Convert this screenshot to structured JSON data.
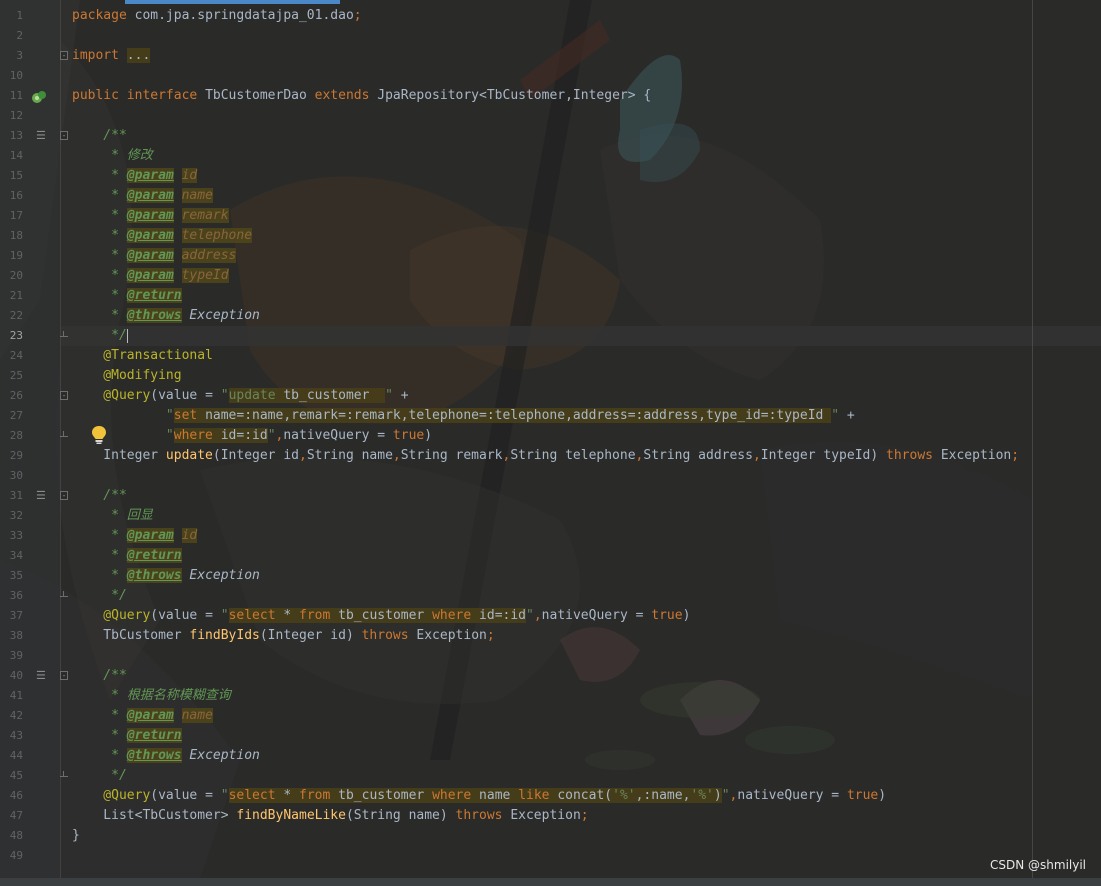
{
  "editor": {
    "lines": [
      {
        "n": "1",
        "segs": [
          [
            "kw",
            "package "
          ],
          [
            "",
            "com.jpa.springdatajpa_01.dao"
          ],
          [
            "kw",
            ";"
          ]
        ]
      },
      {
        "n": "2",
        "segs": []
      },
      {
        "n": "3",
        "fold": "open",
        "segs": [
          [
            "kw",
            "import "
          ],
          [
            "hl",
            "..."
          ]
        ]
      },
      {
        "n": "10",
        "segs": []
      },
      {
        "n": "11",
        "bean": true,
        "segs": [
          [
            "kw",
            "public interface "
          ],
          [
            "",
            "TbCustomerDao "
          ],
          [
            "kw",
            "extends "
          ],
          [
            "",
            "JpaRepository<TbCustomer,Integer> {"
          ]
        ]
      },
      {
        "n": "12",
        "segs": []
      },
      {
        "n": "13",
        "fold": "open",
        "rend": true,
        "segs": [
          [
            "doc",
            "    /**"
          ]
        ]
      },
      {
        "n": "14",
        "segs": [
          [
            "doc",
            "     * 修改"
          ]
        ]
      },
      {
        "n": "15",
        "segs": [
          [
            "doc",
            "     * "
          ],
          [
            "tag",
            "@param"
          ],
          [
            "doc",
            " "
          ],
          [
            "dval",
            "id"
          ]
        ]
      },
      {
        "n": "16",
        "segs": [
          [
            "doc",
            "     * "
          ],
          [
            "tag",
            "@param"
          ],
          [
            "doc",
            " "
          ],
          [
            "dval",
            "name"
          ]
        ]
      },
      {
        "n": "17",
        "segs": [
          [
            "doc",
            "     * "
          ],
          [
            "tag",
            "@param"
          ],
          [
            "doc",
            " "
          ],
          [
            "dval",
            "remark"
          ]
        ]
      },
      {
        "n": "18",
        "segs": [
          [
            "doc",
            "     * "
          ],
          [
            "tag",
            "@param"
          ],
          [
            "doc",
            " "
          ],
          [
            "dval",
            "telephone"
          ]
        ]
      },
      {
        "n": "19",
        "segs": [
          [
            "doc",
            "     * "
          ],
          [
            "tag",
            "@param"
          ],
          [
            "doc",
            " "
          ],
          [
            "dval",
            "address"
          ]
        ]
      },
      {
        "n": "20",
        "segs": [
          [
            "doc",
            "     * "
          ],
          [
            "tag",
            "@param"
          ],
          [
            "doc",
            " "
          ],
          [
            "dval",
            "typeId"
          ]
        ]
      },
      {
        "n": "21",
        "segs": [
          [
            "doc",
            "     * "
          ],
          [
            "tag",
            "@return"
          ]
        ]
      },
      {
        "n": "22",
        "segs": [
          [
            "doc",
            "     * "
          ],
          [
            "tag",
            "@throws"
          ],
          [
            "doc",
            " "
          ],
          [
            "exc",
            "Exception"
          ]
        ]
      },
      {
        "n": "23",
        "fold": "end",
        "cur": true,
        "segs": [
          [
            "doc",
            "     */"
          ],
          [
            "caret",
            ""
          ]
        ]
      },
      {
        "n": "24",
        "segs": [
          [
            "ann",
            "    @Transactional"
          ]
        ]
      },
      {
        "n": "25",
        "segs": [
          [
            "ann",
            "    @Modifying"
          ]
        ]
      },
      {
        "n": "26",
        "fold": "open",
        "segs": [
          [
            "ann",
            "    @Query"
          ],
          [
            "",
            "(value = "
          ],
          [
            "str",
            "\""
          ],
          [
            "hl str",
            "update "
          ],
          [
            "hl",
            "tb_customer  "
          ],
          [
            "str",
            "\""
          ],
          [
            "",
            " +"
          ]
        ]
      },
      {
        "n": "27",
        "segs": [
          [
            "str",
            "            \""
          ],
          [
            "hl kw",
            "set "
          ],
          [
            "hl",
            "name=:name,remark=:remark,telephone=:telephone,address=:address,type_id=:typeId "
          ],
          [
            "str",
            "\""
          ],
          [
            "",
            " +"
          ]
        ]
      },
      {
        "n": "28",
        "bulb": true,
        "fold": "end",
        "segs": [
          [
            "str",
            "            \""
          ],
          [
            "hl kw",
            "where "
          ],
          [
            "hl",
            "id=:id"
          ],
          [
            "str",
            "\""
          ],
          [
            "kw",
            ","
          ],
          [
            "",
            "nativeQuery = "
          ],
          [
            "kw",
            "true"
          ],
          [
            "",
            ")"
          ]
        ]
      },
      {
        "n": "29",
        "segs": [
          [
            "",
            "    Integer "
          ],
          [
            "fn",
            "update"
          ],
          [
            "",
            "(Integer id"
          ],
          [
            "kw",
            ","
          ],
          [
            "",
            "String name"
          ],
          [
            "kw",
            ","
          ],
          [
            "",
            "String remark"
          ],
          [
            "kw",
            ","
          ],
          [
            "",
            "String telephone"
          ],
          [
            "kw",
            ","
          ],
          [
            "",
            "String address"
          ],
          [
            "kw",
            ","
          ],
          [
            "",
            "Integer typeId) "
          ],
          [
            "kw",
            "throws "
          ],
          [
            "",
            "Exception"
          ],
          [
            "kw",
            ";"
          ]
        ]
      },
      {
        "n": "30",
        "segs": []
      },
      {
        "n": "31",
        "fold": "open",
        "rend": true,
        "segs": [
          [
            "doc",
            "    /**"
          ]
        ]
      },
      {
        "n": "32",
        "segs": [
          [
            "doc",
            "     * 回显"
          ]
        ]
      },
      {
        "n": "33",
        "segs": [
          [
            "doc",
            "     * "
          ],
          [
            "tag",
            "@param"
          ],
          [
            "doc",
            " "
          ],
          [
            "dval",
            "id"
          ]
        ]
      },
      {
        "n": "34",
        "segs": [
          [
            "doc",
            "     * "
          ],
          [
            "tag",
            "@return"
          ]
        ]
      },
      {
        "n": "35",
        "segs": [
          [
            "doc",
            "     * "
          ],
          [
            "tag",
            "@throws"
          ],
          [
            "doc",
            " "
          ],
          [
            "exc",
            "Exception"
          ]
        ]
      },
      {
        "n": "36",
        "fold": "end",
        "segs": [
          [
            "doc",
            "     */"
          ]
        ]
      },
      {
        "n": "37",
        "segs": [
          [
            "ann",
            "    @Query"
          ],
          [
            "",
            "(value = "
          ],
          [
            "str",
            "\""
          ],
          [
            "hl kw",
            "select "
          ],
          [
            "hl",
            "* "
          ],
          [
            "hl kw",
            "from "
          ],
          [
            "hl",
            "tb_customer "
          ],
          [
            "hl kw",
            "where "
          ],
          [
            "hl",
            "id=:id"
          ],
          [
            "str",
            "\""
          ],
          [
            "kw",
            ","
          ],
          [
            "",
            "nativeQuery = "
          ],
          [
            "kw",
            "true"
          ],
          [
            "",
            ")"
          ]
        ]
      },
      {
        "n": "38",
        "segs": [
          [
            "",
            "    TbCustomer "
          ],
          [
            "fn",
            "findByIds"
          ],
          [
            "",
            "(Integer id) "
          ],
          [
            "kw",
            "throws "
          ],
          [
            "",
            "Exception"
          ],
          [
            "kw",
            ";"
          ]
        ]
      },
      {
        "n": "39",
        "segs": []
      },
      {
        "n": "40",
        "fold": "open",
        "rend": true,
        "segs": [
          [
            "doc",
            "    /**"
          ]
        ]
      },
      {
        "n": "41",
        "segs": [
          [
            "doc",
            "     * 根据名称模糊查询"
          ]
        ]
      },
      {
        "n": "42",
        "segs": [
          [
            "doc",
            "     * "
          ],
          [
            "tag",
            "@param"
          ],
          [
            "doc",
            " "
          ],
          [
            "dval",
            "name"
          ]
        ]
      },
      {
        "n": "43",
        "segs": [
          [
            "doc",
            "     * "
          ],
          [
            "tag",
            "@return"
          ]
        ]
      },
      {
        "n": "44",
        "segs": [
          [
            "doc",
            "     * "
          ],
          [
            "tag",
            "@throws"
          ],
          [
            "doc",
            " "
          ],
          [
            "exc",
            "Exception"
          ]
        ]
      },
      {
        "n": "45",
        "fold": "end",
        "segs": [
          [
            "doc",
            "     */"
          ]
        ]
      },
      {
        "n": "46",
        "segs": [
          [
            "ann",
            "    @Query"
          ],
          [
            "",
            "(value = "
          ],
          [
            "str",
            "\""
          ],
          [
            "hl kw",
            "select "
          ],
          [
            "hl",
            "* "
          ],
          [
            "hl kw",
            "from "
          ],
          [
            "hl",
            "tb_customer "
          ],
          [
            "hl kw",
            "where "
          ],
          [
            "hl",
            "name "
          ],
          [
            "hl kw",
            "like "
          ],
          [
            "hl",
            "concat("
          ],
          [
            "hl str",
            "'%'"
          ],
          [
            "hl",
            ",:name,"
          ],
          [
            "hl str",
            "'%'"
          ],
          [
            "hl",
            ")"
          ],
          [
            "str",
            "\""
          ],
          [
            "kw",
            ","
          ],
          [
            "",
            "nativeQuery = "
          ],
          [
            "kw",
            "true"
          ],
          [
            "",
            ")"
          ]
        ]
      },
      {
        "n": "47",
        "segs": [
          [
            "",
            "    List<TbCustomer> "
          ],
          [
            "fn",
            "findByNameLike"
          ],
          [
            "",
            "(String name) "
          ],
          [
            "kw",
            "throws "
          ],
          [
            "",
            "Exception"
          ],
          [
            "kw",
            ";"
          ]
        ]
      },
      {
        "n": "48",
        "segs": [
          [
            "",
            "}"
          ]
        ]
      },
      {
        "n": "49",
        "segs": []
      }
    ]
  },
  "watermark": "CSDN @shmilyil",
  "icons": {
    "bean": "spring-bean-icon",
    "bulb": "intention-bulb-icon",
    "render_doc": "render-doc-icon",
    "fold": "fold-marker-icon"
  },
  "colors": {
    "background": "#2b2b2b",
    "keyword": "#cc7832",
    "string": "#6a8759",
    "annotation": "#bbb529",
    "doc_comment": "#629755",
    "method": "#ffc66d",
    "text": "#a9b7c6"
  }
}
